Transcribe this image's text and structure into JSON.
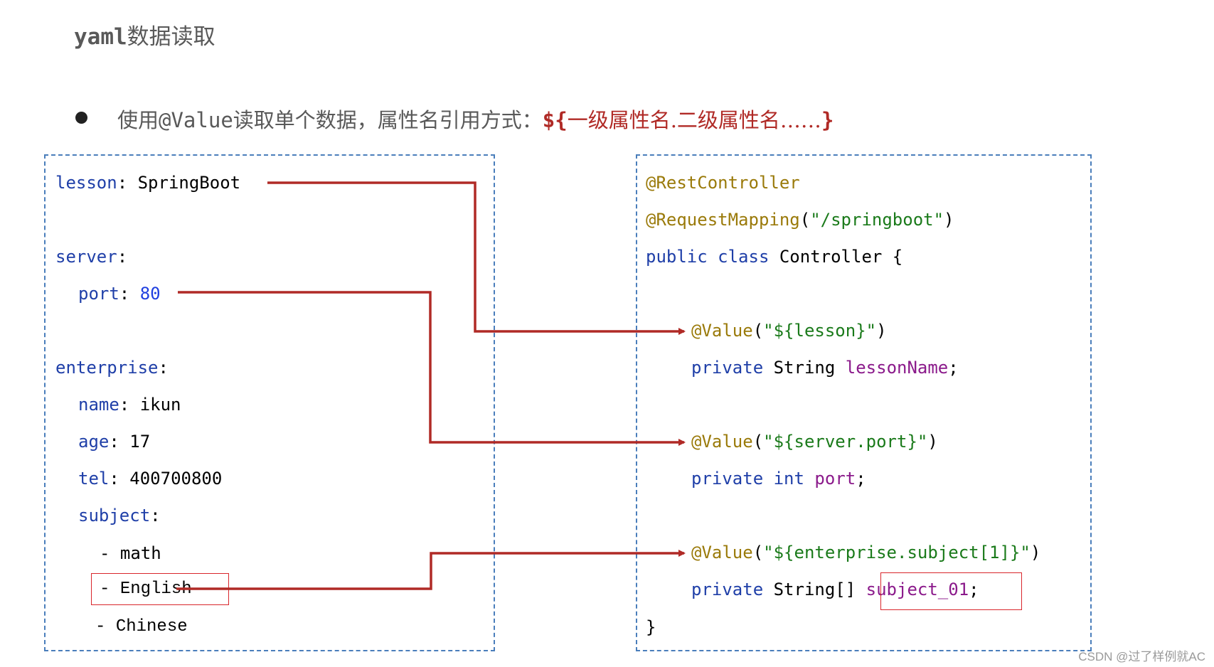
{
  "header": {
    "title_mono": "yaml",
    "title_cjk": "数据读取"
  },
  "bullet": {
    "prefix": "使用",
    "annotation": "@Value",
    "middle": "读取单个数据，属性名引用方式：",
    "syntax_open": "${",
    "syntax_body": "一级属性名.二级属性名……",
    "syntax_close": "}"
  },
  "yaml_panel": {
    "lines": [
      {
        "key": "lesson",
        "sep": ": ",
        "value": "SpringBoot"
      },
      {
        "key": "server",
        "sep": ":",
        "value": ""
      },
      {
        "key": "port",
        "sep": ": ",
        "value": "80"
      },
      {
        "key": "enterprise",
        "sep": ":",
        "value": ""
      },
      {
        "key": "name",
        "sep": ": ",
        "value": "ikun"
      },
      {
        "key": "age",
        "sep": ": ",
        "value": "17"
      },
      {
        "key": "tel",
        "sep": ": ",
        "value": "400700800"
      },
      {
        "key": "subject",
        "sep": ":",
        "value": ""
      },
      {
        "dash": "- ",
        "value": "math"
      },
      {
        "dash": "- ",
        "value": "English"
      },
      {
        "dash": "- ",
        "value": "Chinese"
      }
    ]
  },
  "java_panel": {
    "anno_rest": "@RestController",
    "anno_mapping": "@RequestMapping",
    "mapping_paren_open": "(",
    "mapping_path": "\"/springboot\"",
    "mapping_paren_close": ")",
    "kw_public": "public",
    "kw_class": "class",
    "class_name": "Controller {",
    "fields": [
      {
        "anno": "@Value",
        "open": "(",
        "expr": "\"${lesson}\"",
        "close": ")",
        "kw": "private",
        "type": "String",
        "name": "lessonName",
        "end": ";"
      },
      {
        "anno": "@Value",
        "open": "(",
        "expr": "\"${server.port}\"",
        "close": ")",
        "kw": "private",
        "type": "int",
        "name": "port",
        "end": ";"
      },
      {
        "anno": "@Value",
        "open": "(",
        "expr": "\"${enterprise.subject[1]}\"",
        "close": ")",
        "kw": "private",
        "type": "String[]",
        "name": "subject_01",
        "end": ";"
      }
    ],
    "close_brace": "}"
  },
  "colors": {
    "connector": "#b02a26",
    "box_border": "#4a7ebb",
    "highlight": "#d9262b"
  },
  "watermark": "CSDN @过了样例就AC"
}
